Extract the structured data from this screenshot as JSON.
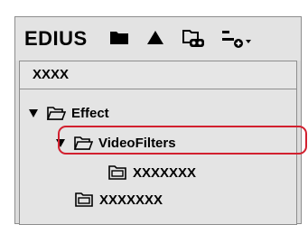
{
  "app": {
    "title": "EDIUS"
  },
  "toolbar": {
    "icons": [
      "folder-icon",
      "triangle-up-icon",
      "folder-link-icon",
      "add-dropdown-icon"
    ]
  },
  "path": {
    "text": "XXXX"
  },
  "tree": {
    "items": [
      {
        "label": "Effect",
        "expanded": true
      },
      {
        "label": "VideoFilters",
        "expanded": true
      },
      {
        "label": "XXXXXXX"
      },
      {
        "label": "XXXXXXX"
      }
    ]
  },
  "colors": {
    "highlight": "#d2202f"
  }
}
